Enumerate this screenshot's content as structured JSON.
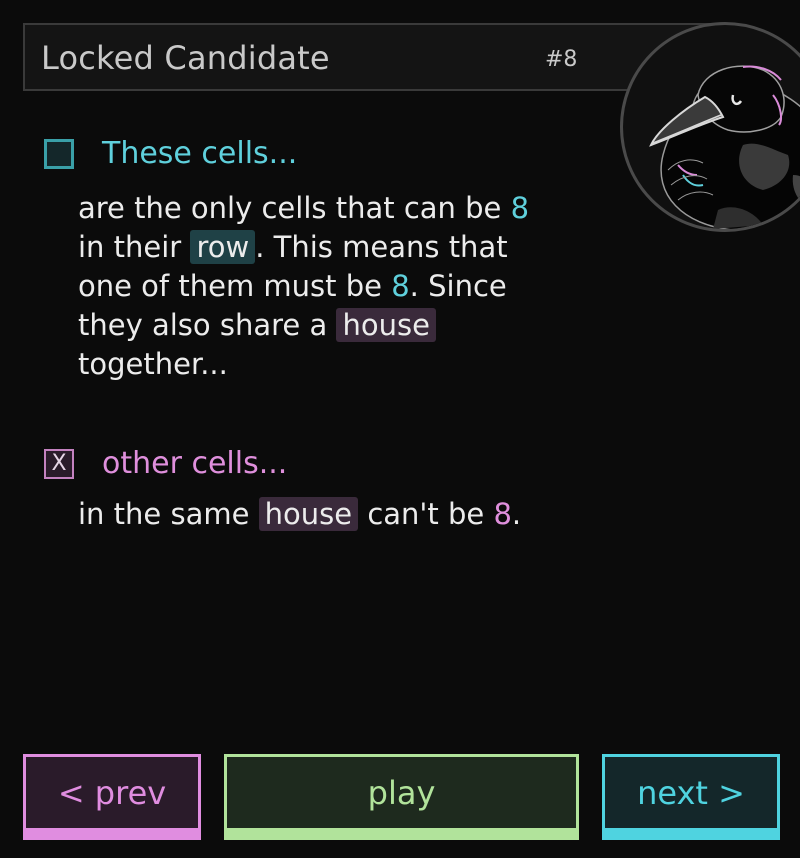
{
  "header": {
    "title": "Locked Candidate",
    "number": "#8"
  },
  "avatar": {
    "icon": "crow-mascot-icon"
  },
  "section1": {
    "checkbox_icon": "empty-checkbox-icon",
    "label": "These cells...",
    "t1": "are the only cells that can be ",
    "n1": "8",
    "t2": "in their ",
    "chip_row": "row",
    "t3": ". This means that one of them must be ",
    "n2": "8",
    "t4": ". Since they also share a ",
    "chip_house": "house",
    "t5": " together..."
  },
  "section2": {
    "checkbox_icon": "x-checkbox-icon",
    "checkbox_mark": "X",
    "label": "other cells...",
    "t1": "in the same ",
    "chip_house": "house",
    "t2": " can't be ",
    "n1": "8",
    "t3": "."
  },
  "buttons": {
    "prev": "< prev",
    "play": "play",
    "next": "next >"
  },
  "colors": {
    "cyan": "#5fd0dc",
    "pink": "#df8fdc",
    "green": "#b1e39b",
    "background": "#0b0b0b"
  }
}
